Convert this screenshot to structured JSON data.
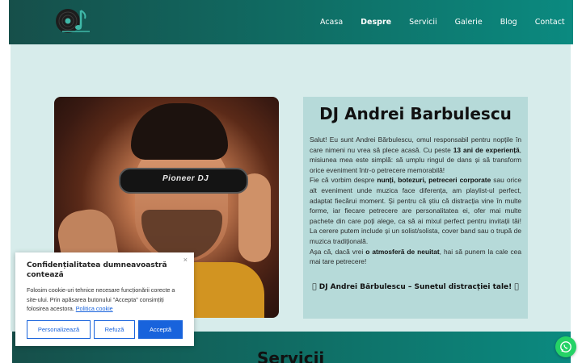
{
  "header": {
    "nav": [
      {
        "label": "Acasa",
        "active": false
      },
      {
        "label": "Despre",
        "active": true
      },
      {
        "label": "Servicii",
        "active": false
      },
      {
        "label": "Galerie",
        "active": false
      },
      {
        "label": "Blog",
        "active": false
      },
      {
        "label": "Contact",
        "active": false
      }
    ],
    "logo_icon": "vinyl-music-note-logo"
  },
  "photo": {
    "headphone_brand": "Pioneer DJ"
  },
  "about": {
    "title": "DJ Andrei Barbulescu",
    "p1_a": "Salut! Eu sunt Andrei Bărbulescu, omul responsabil pentru nopțile în care nimeni nu vrea să plece acasă. Cu peste ",
    "p1_b": "13 ani de experiență",
    "p1_c": ", misiunea mea este simplă: să umplu ringul de dans și să transform orice eveniment într-o petrecere memorabilă!",
    "p2_a": "Fie că vorbim despre ",
    "p2_b": "nunți, botezuri, petreceri corporate",
    "p2_c": " sau orice alt eveniment unde muzica face diferența, am playlist-ul perfect, adaptat fiecărui moment. Și pentru că știu că distracția vine în multe forme, iar fiecare petrecere are personalitatea ei, ofer mai multe pachete din care poți alege, ca să ai mixul perfect pentru invitații tăi! La cerere putem include și un solist/solista, cover band sau o trupă de muzica tradițională.",
    "p3_a": "Așa că, dacă vrei ",
    "p3_b": "o atmosferă de neuitat",
    "p3_c": ", hai să punem la cale cea mai tare petrecere!",
    "tagline": "􏿾 DJ Andrei Bărbulescu – Sunetul distracției tale! 􏿾"
  },
  "services": {
    "title": "Servicii"
  },
  "cookie": {
    "title": "Confidențialitatea dumneavoastră contează",
    "text": "Folosim cookie-uri tehnice necesare funcționării corecte a site-ului. Prin apăsarea butonului \"Accepta\" consimțiți folosirea acestora.",
    "policy_link": "Politica cookie",
    "close": "×",
    "btn_customize": "Personalizează",
    "btn_refuse": "Refuză",
    "btn_accept": "Acceptă"
  },
  "floating": {
    "whatsapp_icon": "whatsapp-icon"
  },
  "colors": {
    "header_dark": "#164f4a",
    "header_light": "#0b8a80",
    "main_bg": "#d7eceb",
    "about_bg": "#b6dad9",
    "cookie_accent": "#1863dc",
    "whatsapp": "#25d366"
  }
}
